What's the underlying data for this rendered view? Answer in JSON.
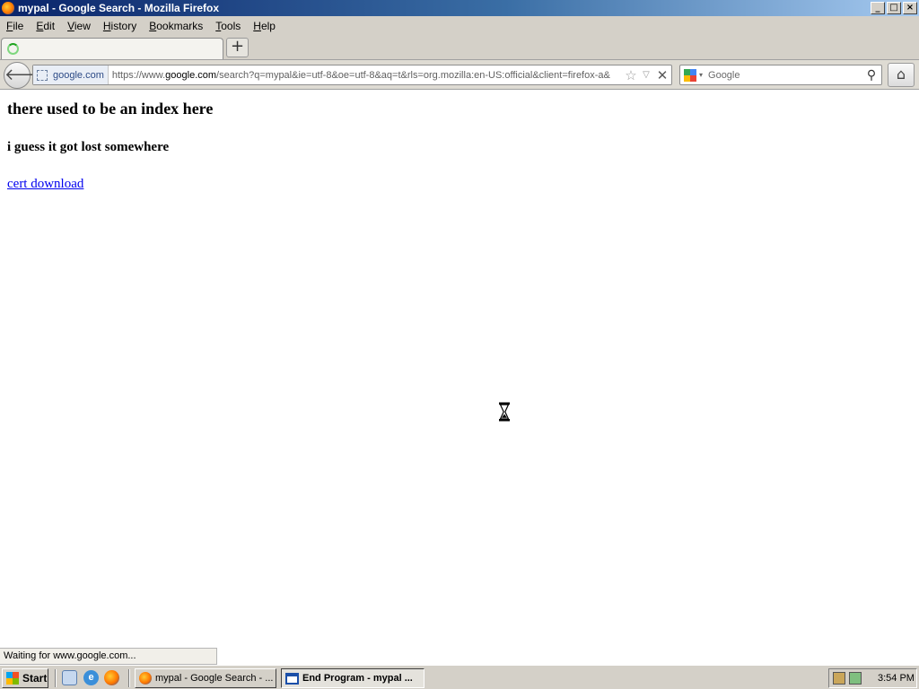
{
  "window": {
    "title": "mypal - Google Search - Mozilla Firefox",
    "controls": {
      "minimize": "_",
      "maximize": "□",
      "close": "×"
    }
  },
  "menubar": {
    "items": [
      {
        "accel": "F",
        "rest": "ile"
      },
      {
        "accel": "E",
        "rest": "dit"
      },
      {
        "accel": "V",
        "rest": "iew"
      },
      {
        "accel": "H",
        "rest": "istory"
      },
      {
        "accel": "B",
        "rest": "ookmarks"
      },
      {
        "accel": "T",
        "rest": "ools"
      },
      {
        "accel": "H",
        "rest": "elp"
      }
    ]
  },
  "tabs": {
    "active_label": "",
    "new_tab_glyph": "+"
  },
  "navbar": {
    "back_glyph": "🡐",
    "identity_label": "google.com",
    "url_prefix": "https://www.",
    "url_host": "google.com",
    "url_rest": "/search?q=mypal&ie=utf-8&oe=utf-8&aq=t&rls=org.mozilla:en-US:official&client=firefox-a&",
    "star_glyph": "☆",
    "dropdown_glyph": "▽",
    "stop_glyph": "✕",
    "search_placeholder": "Google",
    "search_engine_arrow": "▾",
    "search_go_glyph": "⚲",
    "home_glyph": "⌂"
  },
  "page": {
    "heading": "there used to be an index here",
    "subheading": "i guess it got lost somewhere",
    "link_text": "cert download"
  },
  "status": {
    "text": "Waiting for www.google.com..."
  },
  "taskbar": {
    "start_label": "Start",
    "quicklaunch": {
      "ie_glyph": "e"
    },
    "tasks": [
      {
        "label": "mypal - Google Search - ...",
        "active": false
      },
      {
        "label": "End Program - mypal ...",
        "active": true
      }
    ],
    "clock": "3:54 PM"
  }
}
